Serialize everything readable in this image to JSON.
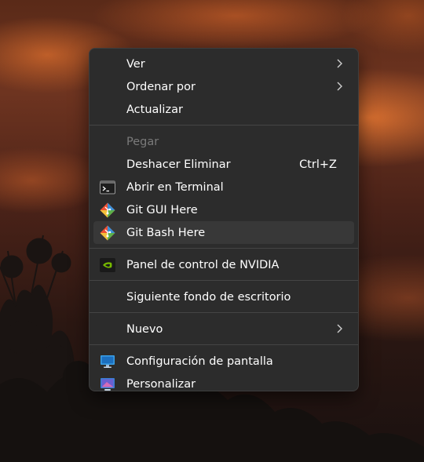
{
  "menu": {
    "items": [
      {
        "label": "Ver",
        "icon": "",
        "submenu": true
      },
      {
        "label": "Ordenar por",
        "icon": "",
        "submenu": true
      },
      {
        "label": "Actualizar",
        "icon": ""
      },
      {
        "label": "Pegar",
        "icon": "",
        "disabled": true
      },
      {
        "label": "Deshacer Eliminar",
        "shortcut": "Ctrl+Z",
        "icon": ""
      },
      {
        "label": "Abrir en Terminal",
        "icon": "terminal-icon"
      },
      {
        "label": "Git GUI Here",
        "icon": "git-icon"
      },
      {
        "label": "Git Bash Here",
        "icon": "git-icon",
        "highlighted": true
      },
      {
        "label": "Panel de control de NVIDIA",
        "icon": "nvidia-icon"
      },
      {
        "label": "Siguiente fondo de escritorio",
        "icon": ""
      },
      {
        "label": "Nuevo",
        "icon": "",
        "submenu": true
      },
      {
        "label": "Configuración de pantalla",
        "icon": "display-icon"
      },
      {
        "label": "Personalizar",
        "icon": "personalize-icon"
      }
    ]
  },
  "colors": {
    "menu_bg": "#2c2c2c",
    "highlight_bg": "#383838",
    "text": "#ffffff",
    "disabled_text": "#7a7a7a",
    "git_orange": "#f05033",
    "nvidia_green": "#76b900"
  }
}
